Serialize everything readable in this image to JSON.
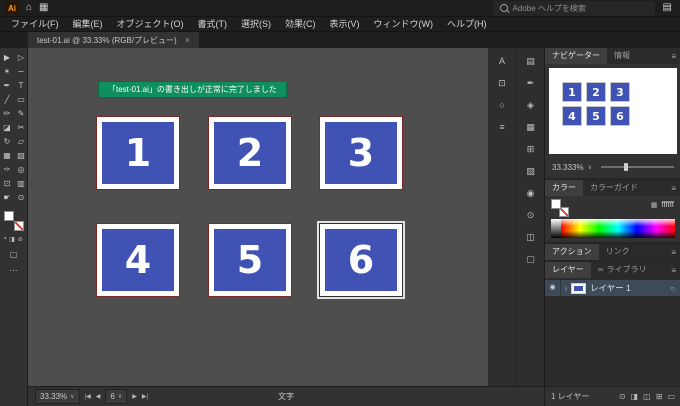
{
  "colors": {
    "accent_blue": "#4053b4",
    "toast_green": "#0f8f5f",
    "canvas_bg": "#4e4e4e",
    "chrome_dark": "#1e1e1e",
    "panel_bg": "#323232",
    "artboard_edge_red": "#7a2a28"
  },
  "app": {
    "logo": "Ai",
    "search_placeholder": "Adobe ヘルプを検索",
    "menus": [
      "ファイル(F)",
      "編集(E)",
      "オブジェクト(O)",
      "書式(T)",
      "選択(S)",
      "効果(C)",
      "表示(V)",
      "ウィンドウ(W)",
      "ヘルプ(H)"
    ]
  },
  "doc": {
    "tab_title": "test-01.ai @ 33.33% (RGB/プレビュー)"
  },
  "toast": {
    "message": "「test-01.ai」の書き出しが正常に完了しました"
  },
  "canvas": {
    "tiles": [
      "1",
      "2",
      "3",
      "4",
      "5",
      "6"
    ]
  },
  "status": {
    "zoom": "33.33%",
    "artboard": "6",
    "first": "|◀",
    "prev": "◀",
    "next": "▶",
    "last": "▶|",
    "tool": "文字"
  },
  "panels": {
    "navigator": {
      "tab_active": "ナビゲーター",
      "tab_inactive": "情報",
      "zoom": "33.333%"
    },
    "color": {
      "tab_active": "カラー",
      "tab_inactive": "カラーガイド",
      "hex": "ffffff"
    },
    "actions": {
      "tab_active": "アクション",
      "tab_inactive": "リンク"
    },
    "layers": {
      "tab_active": "レイヤー",
      "tab_inactive": "ライブラリ",
      "layer_name": "レイヤー 1",
      "count": "1 レイヤー"
    }
  },
  "icons": {
    "home": "⌂",
    "apps": "▦",
    "workspace": "▤",
    "close": "×",
    "panel_menu": "≡",
    "chevron_down": "∨",
    "chevron_right": "›",
    "eye": "◉",
    "target": "○",
    "infinity": "∞",
    "hex_grid": "▦",
    "screen_mode": "▢",
    "more": "⋯",
    "tools": [
      "▶",
      "▷",
      "✶",
      "∽",
      "✒",
      "T",
      "╱",
      "▭",
      "✏",
      "✎",
      "◪",
      "✂",
      "↻",
      "▱",
      "▦",
      "▧",
      "✑",
      "◎",
      "⊡",
      "▥",
      "☛",
      "⊙"
    ],
    "tool_minis": [
      "▪",
      "◨",
      "⊘"
    ],
    "dock_col1": [
      "A",
      "⊡",
      "○",
      "≡"
    ],
    "dock_col2": [
      "▤",
      "✒",
      "◈",
      "▦",
      "⊞",
      "▧",
      "◉",
      "⊙",
      "◫",
      "▢"
    ],
    "layer_footer": [
      "⊙",
      "◨",
      "◫",
      "⊞",
      "▭"
    ]
  }
}
